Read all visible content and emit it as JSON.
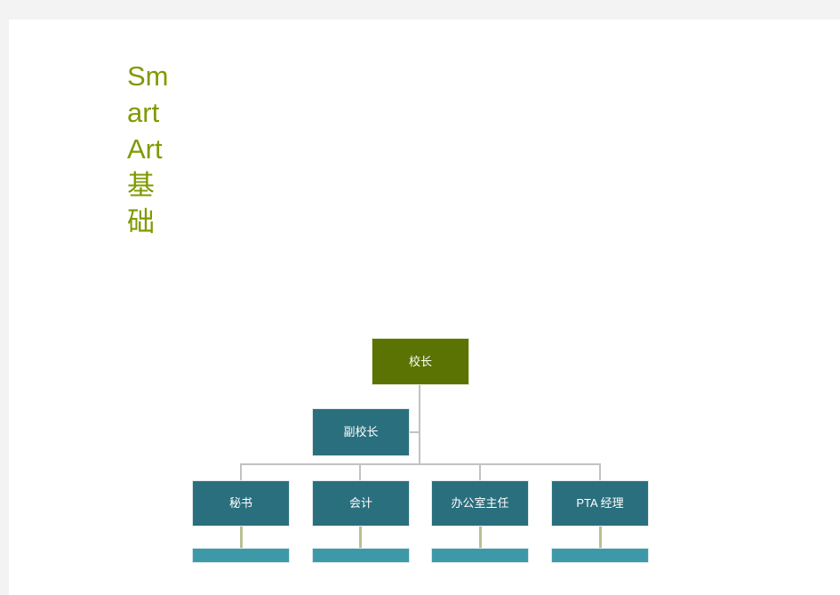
{
  "slide": {
    "title": "SmartArt基础",
    "background_color": "#ffffff",
    "canvas_color": "#f3f3f4",
    "title_color": "#7f9a00"
  },
  "smartart": {
    "type": "organization-chart",
    "colors": {
      "root_fill": "#5a7302",
      "branch_fill": "#2a6f7d",
      "bar_fill": "#3d99a8",
      "connector": "#c2c2c2",
      "stub_connector": "#b7c191",
      "node_text": "#ffffff"
    },
    "nodes": {
      "root": {
        "label": "校长"
      },
      "assistant": {
        "label": "副校长"
      },
      "children": [
        {
          "label": "秘书",
          "bar_label": ""
        },
        {
          "label": "会计",
          "bar_label": ""
        },
        {
          "label": "办公室主任",
          "bar_label": ""
        },
        {
          "label": "PTA 经理",
          "bar_label": ""
        }
      ]
    }
  }
}
